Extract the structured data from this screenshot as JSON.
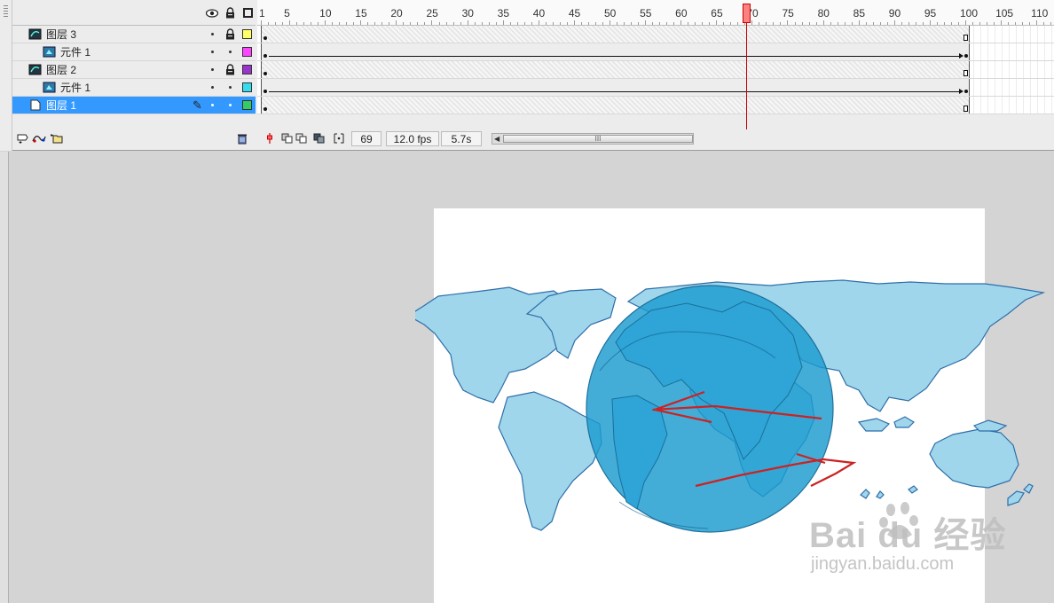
{
  "timeline": {
    "ruler_labels": [
      "1",
      "5",
      "10",
      "15",
      "20",
      "25",
      "30",
      "35",
      "40",
      "45",
      "50",
      "55",
      "60",
      "65",
      "70",
      "75",
      "80",
      "85",
      "90",
      "95",
      "100",
      "105",
      "110"
    ],
    "current_frame_marker": "70",
    "layers": [
      {
        "name": "图层 3",
        "kind": "guide-layer",
        "swatch": "#ffff66",
        "locked": true,
        "indent": false,
        "selected": false
      },
      {
        "name": "元件 1",
        "kind": "symbol-layer",
        "swatch": "#ff44ff",
        "locked": false,
        "indent": true,
        "selected": false
      },
      {
        "name": "图层 2",
        "kind": "guide-layer",
        "swatch": "#9933cc",
        "locked": true,
        "indent": false,
        "selected": false
      },
      {
        "name": "元件 1",
        "kind": "symbol-layer",
        "swatch": "#33ddee",
        "locked": false,
        "indent": true,
        "selected": false
      },
      {
        "name": "图层 1",
        "kind": "normal-layer",
        "swatch": "#33cc66",
        "locked": false,
        "indent": false,
        "selected": true
      }
    ],
    "status": {
      "current_frame": "69",
      "frame_rate": "12.0 fps",
      "elapsed_time": "5.7s"
    },
    "icons": {
      "eye": "eye-icon",
      "lock": "lock-icon",
      "outline": "outline-icon",
      "add_layer": "add-layer-icon",
      "add_guide": "add-motion-guide-icon",
      "add_folder": "add-folder-icon",
      "delete": "trash-icon",
      "center_frame": "center-frame-icon",
      "onion_skin": "onion-skin-icon",
      "onion_outline": "onion-skin-outline-icon",
      "edit_multiple": "edit-multiple-frames-icon",
      "onion_markers": "modify-onion-markers-icon"
    },
    "colors": {
      "selected_row": "#3399ff",
      "playhead": "#cc0000"
    }
  },
  "stage": {
    "background": "#ffffff",
    "map_color": "#9fd6ec",
    "globe_color": "#1a9bd0",
    "stroke_color": "#cc2222"
  },
  "watermark": {
    "logo": "Bai du 经验",
    "url": "jingyan.baidu.com"
  }
}
